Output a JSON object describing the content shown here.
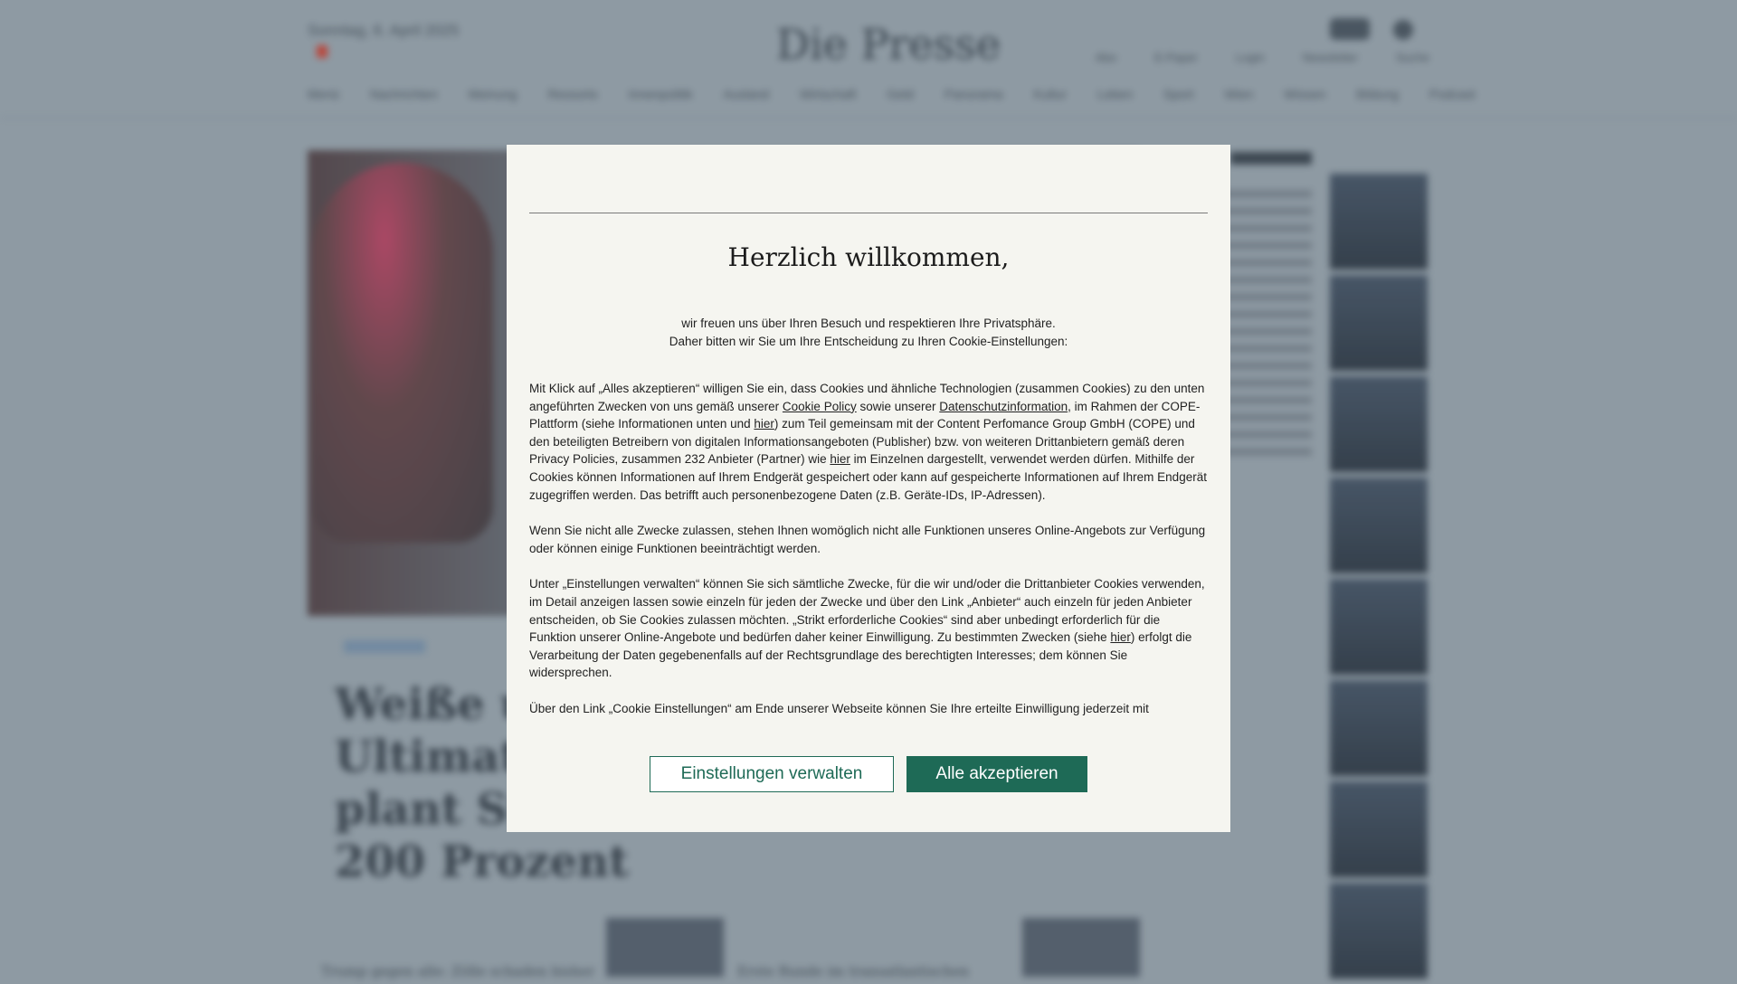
{
  "background": {
    "header_left": "Sonntag, 6. April 2025",
    "logo": "Die Presse",
    "header_links": [
      "Abo",
      "E-Paper",
      "Login",
      "Newsletter",
      "Suche"
    ],
    "nav_items": [
      "Menü",
      "Nachrichten",
      "Meinung",
      "Ressorts",
      "Innenpolitik",
      "Ausland",
      "Wirtschaft",
      "Geld",
      "Panorama",
      "Kultur",
      "Leben",
      "Sport",
      "Wien",
      "Wissen",
      "Bildung",
      "Podcast"
    ],
    "headline": "Weiße und Ultimatum: Kurz plant Strafzölle von 200 Prozent",
    "bottom_teaser_1": "Trump gegen alle: Zölle schaden bisher",
    "bottom_teaser_2": "Erste Runde im transatlantischen"
  },
  "modal": {
    "title": "Herzlich willkommen,",
    "intro_line1": "wir freuen uns über Ihren Besuch und respektieren Ihre Privatsphäre.",
    "intro_line2": "Daher bitten wir Sie um Ihre Entscheidung zu Ihren Cookie-Einstellungen:",
    "p1_a": "Mit Klick auf „Alles akzeptieren“ willigen Sie ein, dass Cookies und ähnliche Technologien (zusammen Cookies) zu den unten angeführten Zwecken von uns gemäß unserer ",
    "p1_link_cookie": "Cookie Policy",
    "p1_b": " sowie unserer ",
    "p1_link_datenschutz": "Datenschutzinformation",
    "p1_c": ", im Rahmen der COPE-Plattform (siehe Informationen unten und ",
    "p1_link_hier1": "hier",
    "p1_d": ") zum Teil gemeinsam mit der Content Perfomance Group GmbH (COPE) und den beteiligten Betreibern von digitalen Informationsangeboten (Publisher) bzw. von weiteren Drittanbietern gemäß deren Privacy Policies, zusammen 232 Anbieter (Partner) wie ",
    "p1_link_hier2": "hier",
    "p1_e": " im Einzelnen dargestellt, verwendet werden dürfen. Mithilfe der Cookies können Informationen auf Ihrem Endgerät gespeichert oder kann auf gespeicherte Informationen auf Ihrem Endgerät zugegriffen werden. Das betrifft auch personenbezogene Daten (z.B. Geräte-IDs, IP-Adressen).",
    "p2": "Wenn Sie nicht alle Zwecke zulassen, stehen Ihnen womöglich nicht alle Funktionen unseres Online-Angebots zur Verfügung oder können einige Funktionen beeinträchtigt werden.",
    "p3_a": "Unter „Einstellungen verwalten“ können Sie sich sämtliche Zwecke, für die wir und/oder die Drittanbieter Cookies verwenden, im Detail anzeigen lassen sowie einzeln für jeden der Zwecke und über den Link „Anbieter“ auch einzeln für jeden Anbieter entscheiden, ob Sie Cookies zulassen möchten. „Strikt erforderliche Cookies“ sind aber unbedingt erforderlich für die Funktion unserer Online-Angebote und bedürfen daher keiner Einwilligung. Zu bestimmten Zwecken (siehe ",
    "p3_link_hier": "hier",
    "p3_b": ") erfolgt die Verarbeitung der Daten gegebenenfalls auf der Rechtsgrundlage des berechtigten Interesses; dem können Sie widersprechen.",
    "p4": "Über den Link „Cookie Einstellungen“ am Ende unserer Webseite können Sie Ihre erteilte Einwilligung jederzeit mit",
    "btn_manage": "Einstellungen verwalten",
    "btn_accept": "Alle akzeptieren"
  },
  "colors": {
    "accent": "#1e6a56",
    "modal_bg": "#f5f5f0"
  }
}
